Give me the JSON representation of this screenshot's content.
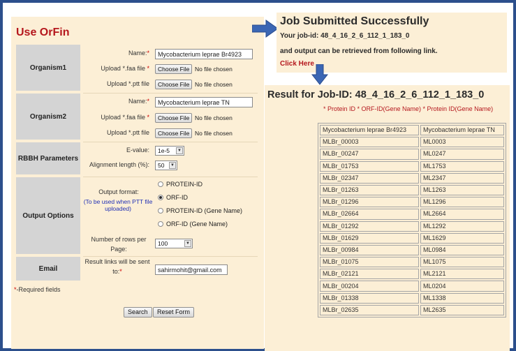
{
  "form": {
    "title": "Use OrFin",
    "required_mark": "*",
    "organism1": {
      "section_label": "Organism1",
      "name_label": "Name:",
      "name_value": "Mycobacterium leprae Br4923",
      "faa_label": "Upload *.faa file",
      "ptt_label": "Upload *.ptt file",
      "choose_file": "Choose File",
      "no_file": "No file chosen"
    },
    "organism2": {
      "section_label": "Organism2",
      "name_label": "Name:",
      "name_value": "Mycobacterium leprae TN",
      "faa_label": "Upload *.faa file",
      "ptt_label": "Upload *.ptt file",
      "choose_file": "Choose File",
      "no_file": "No file chosen"
    },
    "rbbh": {
      "section_label": "RBBH Parameters",
      "evalue_label": "E-value:",
      "evalue_value": "1e-5",
      "alignment_label": "Alignment length (%):",
      "alignment_value": "50"
    },
    "output": {
      "section_label": "Output Options",
      "format_label": "Output format:",
      "ptt_note": "(To be used when PTT file uploaded)",
      "options": [
        "PROTEIN-ID",
        "ORF-ID",
        "PROTEIN-ID (Gene Name)",
        "ORF-ID (Gene Name)"
      ],
      "selected": "ORF-ID",
      "rows_label": "Number of rows per Page:",
      "rows_value": "100"
    },
    "email": {
      "section_label": "Email",
      "label": "Result links will be sent to:",
      "value": "sahirmohit@gmail.com"
    },
    "required_note": "-Required fields",
    "search_button": "Search",
    "reset_button": "Reset Form"
  },
  "job": {
    "title": "Job Submitted Successfully",
    "id_line": "Your job-id: 48_4_16_2_6_112_1_183_0",
    "retrieve_line": "and output can be retrieved from following link.",
    "click_here": "Click Here"
  },
  "result": {
    "title": "Result for Job-ID: 48_4_16_2_6_112_1_183_0",
    "legend": "* Protein ID * ORF-ID(Gene Name) * Protein ID(Gene Name)",
    "columns": [
      "Mycobacterium leprae Br4923",
      "Mycobacterium leprae TN"
    ],
    "rows": [
      [
        "MLBr_00003",
        "ML0003"
      ],
      [
        "MLBr_00247",
        "ML0247"
      ],
      [
        "MLBr_01753",
        "ML1753"
      ],
      [
        "MLBr_02347",
        "ML2347"
      ],
      [
        "MLBr_01263",
        "ML1263"
      ],
      [
        "MLBr_01296",
        "ML1296"
      ],
      [
        "MLBr_02664",
        "ML2664"
      ],
      [
        "MLBr_01292",
        "ML1292"
      ],
      [
        "MLBr_01629",
        "ML1629"
      ],
      [
        "MLBr_00984",
        "ML0984"
      ],
      [
        "MLBr_01075",
        "ML1075"
      ],
      [
        "MLBr_02121",
        "ML2121"
      ],
      [
        "MLBr_00204",
        "ML0204"
      ],
      [
        "MLBr_01338",
        "ML1338"
      ],
      [
        "MLBr_02635",
        "ML2635"
      ]
    ]
  },
  "colors": {
    "frame": "#2c4f8c",
    "panel": "#fcefd6",
    "accent_red": "#b5171d",
    "arrow": "#3b66b4",
    "note_blue": "#1f2fb5"
  },
  "icons": {
    "arrow_right": "right-arrow-icon",
    "arrow_down": "down-arrow-icon",
    "select_caret": "chevron-down-icon"
  }
}
